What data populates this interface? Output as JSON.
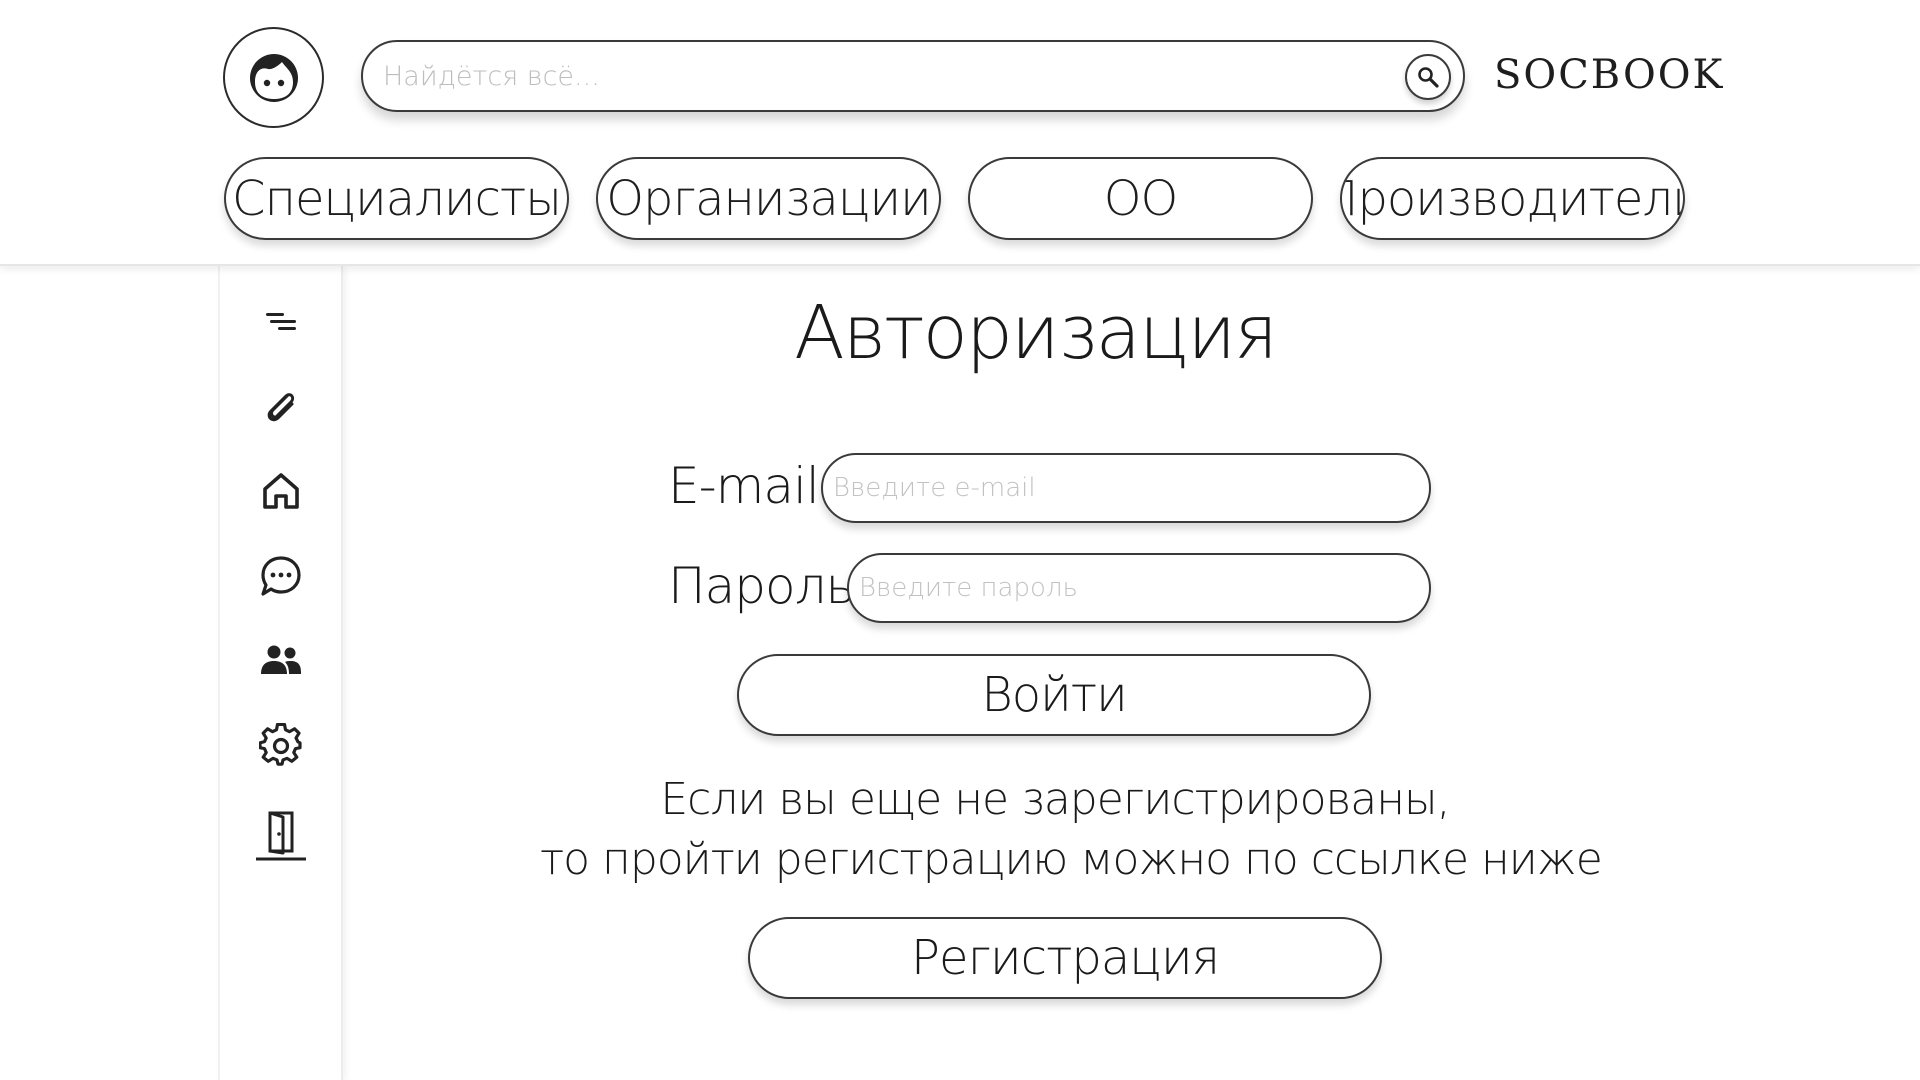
{
  "header": {
    "avatar_icon": "user-face-icon",
    "search": {
      "placeholder": "Найдётся всё...",
      "button_icon": "search-icon"
    },
    "brand": "SOCBOOK",
    "categories": [
      {
        "label": "Специалисты"
      },
      {
        "label": "Организации"
      },
      {
        "label": "ОО"
      },
      {
        "label": "Производители"
      }
    ]
  },
  "sidebar": {
    "items": [
      {
        "icon": "menu-lines-icon"
      },
      {
        "icon": "paperclip-icon"
      },
      {
        "icon": "home-icon"
      },
      {
        "icon": "chat-bubble-icon"
      },
      {
        "icon": "users-icon"
      },
      {
        "icon": "gear-icon"
      },
      {
        "icon": "door-login-icon"
      }
    ]
  },
  "auth": {
    "title": "Авторизация",
    "email": {
      "label": "E-mail",
      "placeholder": "Введите e-mail"
    },
    "password": {
      "label": "Пароль",
      "placeholder": "Введите пароль"
    },
    "login_button": "Войти",
    "info_line1": "Если вы еще не зарегистрированы,",
    "info_line2": "то пройти регистрацию можно по ссылке ниже",
    "register_button": "Регистрация"
  },
  "colors": {
    "background": "#ffffff",
    "stroke": "#3a3a3a",
    "text": "#1a1a1a",
    "placeholder": "#c2c2c2"
  }
}
